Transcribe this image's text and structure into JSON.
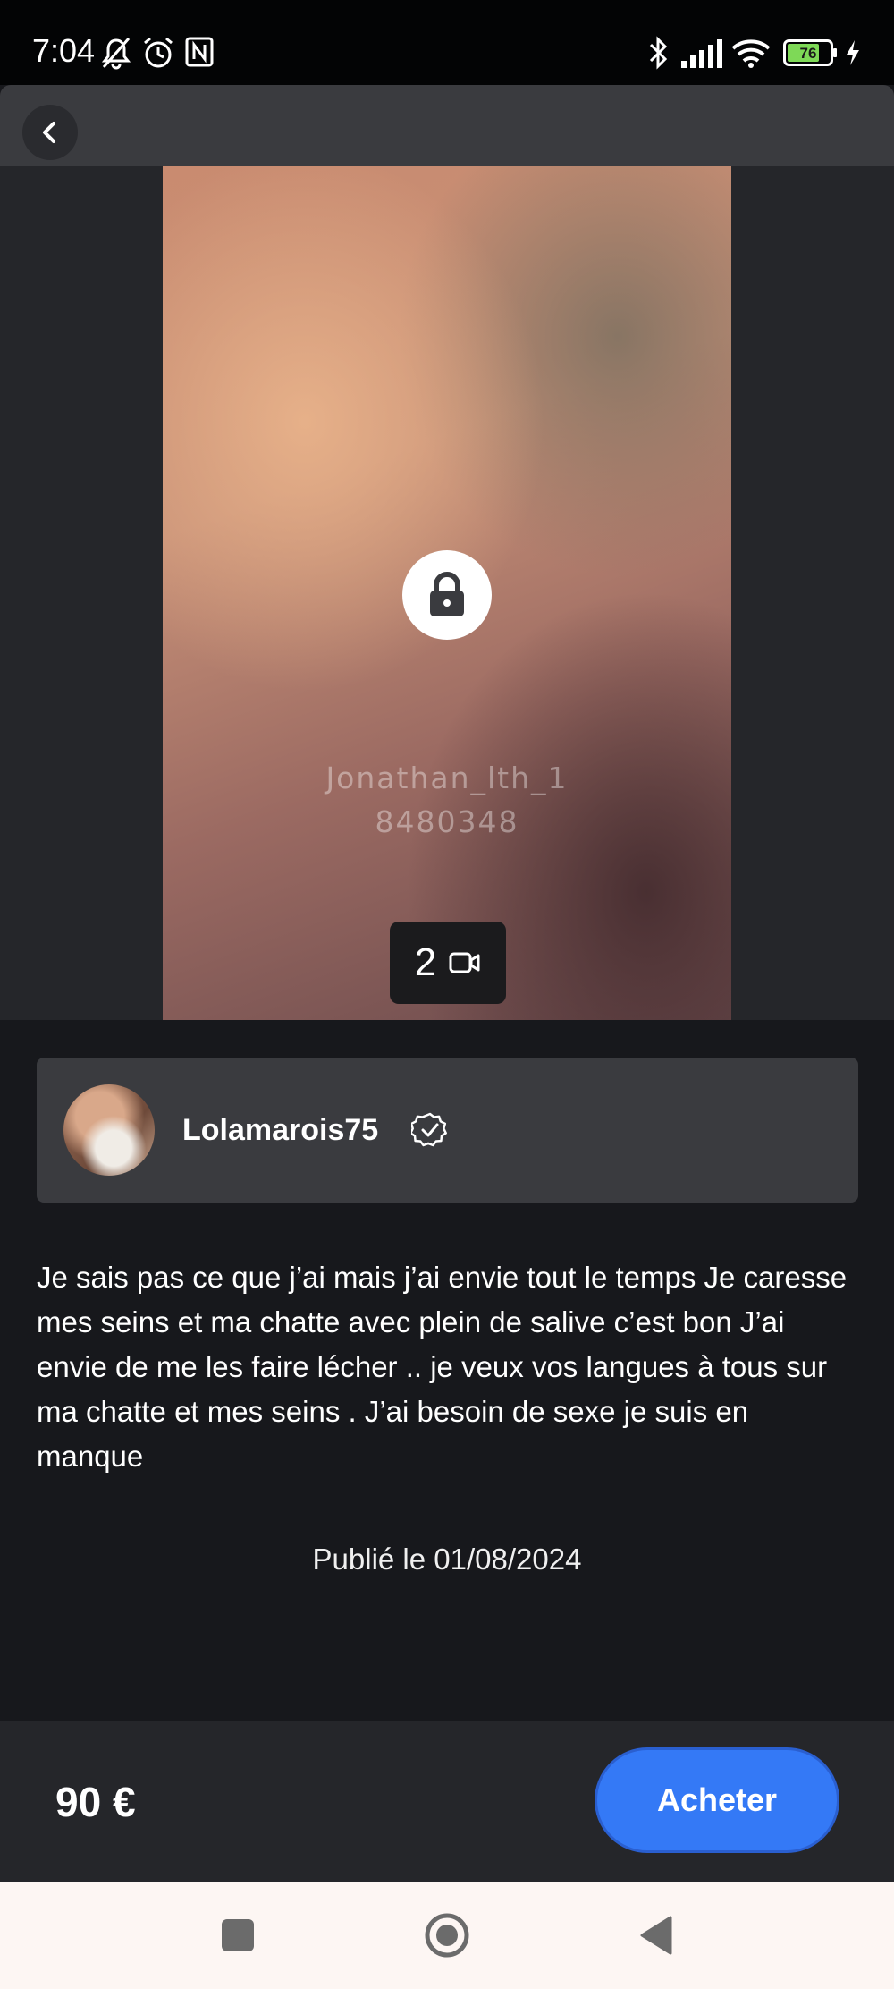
{
  "status_bar": {
    "time": "7:04",
    "battery": "76",
    "icons": [
      "bell-off-icon",
      "alarm-icon",
      "nfc-icon",
      "bluetooth-icon",
      "signal-icon",
      "wifi-icon",
      "battery-icon",
      "charging-icon"
    ]
  },
  "header": {
    "back_icon": "chevron-left-icon"
  },
  "media": {
    "watermark_line1": "Jonathan_lth_1",
    "watermark_line2": "8480348",
    "count": "2",
    "count_icon": "video-icon",
    "lock_icon": "lock-icon"
  },
  "creator": {
    "name": "Lolamarois75",
    "verified_icon": "verified-badge-icon"
  },
  "post": {
    "description": "Je sais pas ce que j’ai mais j’ai envie tout le temps Je caresse mes seins et ma chatte avec plein de salive c’est bon J’ai envie de me les faire lécher .. je veux vos langues à tous sur ma chatte et mes seins . J’ai besoin de sexe je suis en manque",
    "published": "Publié le 01/08/2024"
  },
  "purchase": {
    "price": "90 €",
    "buy_label": "Acheter"
  },
  "colors": {
    "accent": "#3479f6",
    "background": "#17181c",
    "card": "#3a3b3f",
    "battery_fill": "#7ed957"
  },
  "nav": {
    "icons": [
      "recents-square-icon",
      "home-circle-icon",
      "back-triangle-icon"
    ]
  }
}
